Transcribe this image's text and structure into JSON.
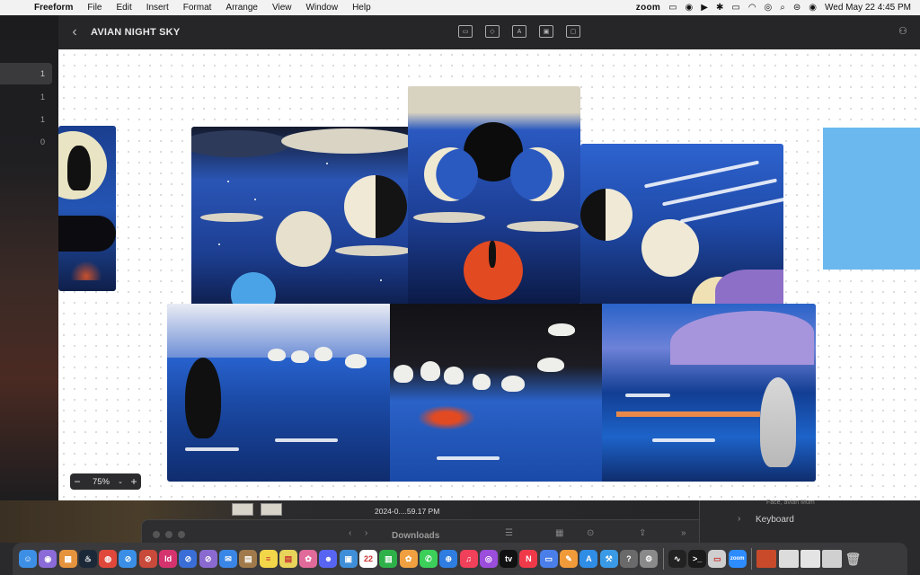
{
  "menubar": {
    "app_name": "Freeform",
    "items": [
      "File",
      "Edit",
      "Insert",
      "Format",
      "Arrange",
      "View",
      "Window",
      "Help"
    ],
    "status_zoom": "zoom",
    "datetime": "Wed May 22  4:45 PM"
  },
  "sidebar": {
    "counts": [
      "1",
      "1",
      "1",
      "0"
    ]
  },
  "board": {
    "title": "AVIAN NIGHT SKY"
  },
  "zoom": {
    "minus": "−",
    "value": "75%",
    "chevron": "⌄",
    "plus": "+"
  },
  "desktop": {
    "file_label": "2024-0....59.17 PM"
  },
  "finder": {
    "title": "Downloads"
  },
  "inspector": {
    "section_title": "Keyboard",
    "cut_text": "Face, avian Mum"
  },
  "dock": {
    "apps": [
      {
        "name": "finder",
        "color": "#3d8fe6",
        "glyph": "☺"
      },
      {
        "name": "siri",
        "color": "#8a6bd8",
        "glyph": "◉"
      },
      {
        "name": "launchpad",
        "color": "#e6933d",
        "glyph": "▦"
      },
      {
        "name": "steam",
        "color": "#1b2838",
        "glyph": "♨"
      },
      {
        "name": "chrome",
        "color": "#e0483c",
        "glyph": "◍"
      },
      {
        "name": "safari",
        "color": "#3a8ee6",
        "glyph": "⊘"
      },
      {
        "name": "app-red",
        "color": "#c84a3a",
        "glyph": "⊘"
      },
      {
        "name": "indesign",
        "color": "#d4336e",
        "glyph": "Id"
      },
      {
        "name": "app-blue",
        "color": "#3a6ed6",
        "glyph": "⊘"
      },
      {
        "name": "app-purple",
        "color": "#8a6ad0",
        "glyph": "⊘"
      },
      {
        "name": "mail",
        "color": "#3a86e6",
        "glyph": "✉"
      },
      {
        "name": "notes-brown",
        "color": "#a07a4a",
        "glyph": "▤"
      },
      {
        "name": "notes",
        "color": "#f2d64a",
        "glyph": "≡"
      },
      {
        "name": "stickies",
        "color": "#e8d45a",
        "glyph": "▤"
      },
      {
        "name": "photos-app",
        "color": "#e06a9a",
        "glyph": "✿"
      },
      {
        "name": "discord",
        "color": "#5865f2",
        "glyph": "☻"
      },
      {
        "name": "preview",
        "color": "#3f8fd8",
        "glyph": "▣"
      },
      {
        "name": "calendar",
        "color": "#ffffff",
        "glyph": "22"
      },
      {
        "name": "numbers",
        "color": "#2fb14a",
        "glyph": "▥"
      },
      {
        "name": "photos",
        "color": "#f0a040",
        "glyph": "✿"
      },
      {
        "name": "messages",
        "color": "#3ccf5a",
        "glyph": "✆"
      },
      {
        "name": "appstore-badge",
        "color": "#2f7de0",
        "glyph": "⊕"
      },
      {
        "name": "music",
        "color": "#f0405a",
        "glyph": "♫"
      },
      {
        "name": "podcasts",
        "color": "#9b4ddc",
        "glyph": "◎"
      },
      {
        "name": "tv",
        "color": "#111111",
        "glyph": "tv"
      },
      {
        "name": "news",
        "color": "#f03a4a",
        "glyph": "N"
      },
      {
        "name": "keynote",
        "color": "#4a7ee8",
        "glyph": "▭"
      },
      {
        "name": "pages",
        "color": "#f09a3a",
        "glyph": "✎"
      },
      {
        "name": "appstore",
        "color": "#2f8de6",
        "glyph": "A"
      },
      {
        "name": "xcode",
        "color": "#3a9ae6",
        "glyph": "⚒"
      },
      {
        "name": "help",
        "color": "#6a6a6a",
        "glyph": "?"
      },
      {
        "name": "settings",
        "color": "#8a8a8a",
        "glyph": "⚙"
      },
      {
        "name": "activity",
        "color": "#222222",
        "glyph": "∿"
      },
      {
        "name": "terminal",
        "color": "#1a1a1a",
        "glyph": ">_"
      },
      {
        "name": "screenshot",
        "color": "#cfcfcf",
        "glyph": "▭"
      },
      {
        "name": "zoom",
        "color": "#2d8cff",
        "glyph": "zoom"
      }
    ],
    "docs": [
      {
        "name": "doc-thumb-1",
        "color": "#c84a2a"
      },
      {
        "name": "doc-thumb-2",
        "color": "#dcdcdc"
      },
      {
        "name": "doc-thumb-3",
        "color": "#e4e4e4"
      },
      {
        "name": "doc-thumb-4",
        "color": "#d0d0d0"
      }
    ]
  },
  "colors": {
    "canvas_bg": "#ffffff",
    "blue_shape": "#6bb8ef",
    "titlebar": "#262628"
  }
}
